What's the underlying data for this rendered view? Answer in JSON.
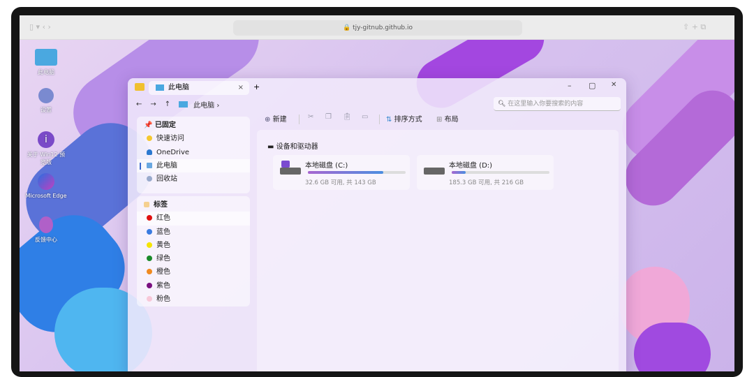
{
  "browser": {
    "url": "tjy-gitnub.github.io"
  },
  "desktop": [
    {
      "label": "此电脑",
      "icon": "monitor-icon"
    },
    {
      "label": "设置",
      "icon": "gear-icon"
    },
    {
      "label": "关于 Win12 预览版",
      "icon": "info-icon"
    },
    {
      "label": "Microsoft Edge",
      "icon": "edge-icon"
    },
    {
      "label": "反馈中心",
      "icon": "feedback-icon"
    }
  ],
  "window": {
    "tab": "此电脑",
    "tab_close": "×",
    "new_tab": "+",
    "nav": {
      "back": "←",
      "forward": "→",
      "up": "↑",
      "path": "此电脑",
      "chevron": "›"
    },
    "controls": {
      "min": "–",
      "max": "▢",
      "close": "✕"
    },
    "search_placeholder": "在这里输入你要搜索的内容",
    "sidebar": {
      "pinned_title": "已固定",
      "pinned": [
        "快速访问",
        "OneDrive",
        "此电脑",
        "回收站"
      ],
      "tags_title": "标签",
      "tags": [
        {
          "label": "红色",
          "color": "#e01010"
        },
        {
          "label": "蓝色",
          "color": "#3a7be0"
        },
        {
          "label": "黄色",
          "color": "#f5e400"
        },
        {
          "label": "绿色",
          "color": "#1a8a2a"
        },
        {
          "label": "橙色",
          "color": "#f08a20"
        },
        {
          "label": "紫色",
          "color": "#7a1080"
        },
        {
          "label": "粉色",
          "color": "#f8c8d8"
        }
      ]
    },
    "toolbar": {
      "new": "新建",
      "sort": "排序方式",
      "layout": "布局"
    },
    "section": "设备和驱动器",
    "drives": [
      {
        "name": "本地磁盘 (C:)",
        "size": "32.6 GB 可用, 共 143 GB",
        "used": 0.77
      },
      {
        "name": "本地磁盘 (D:)",
        "size": "185.3 GB 可用, 共 216 GB",
        "used": 0.14
      }
    ]
  }
}
